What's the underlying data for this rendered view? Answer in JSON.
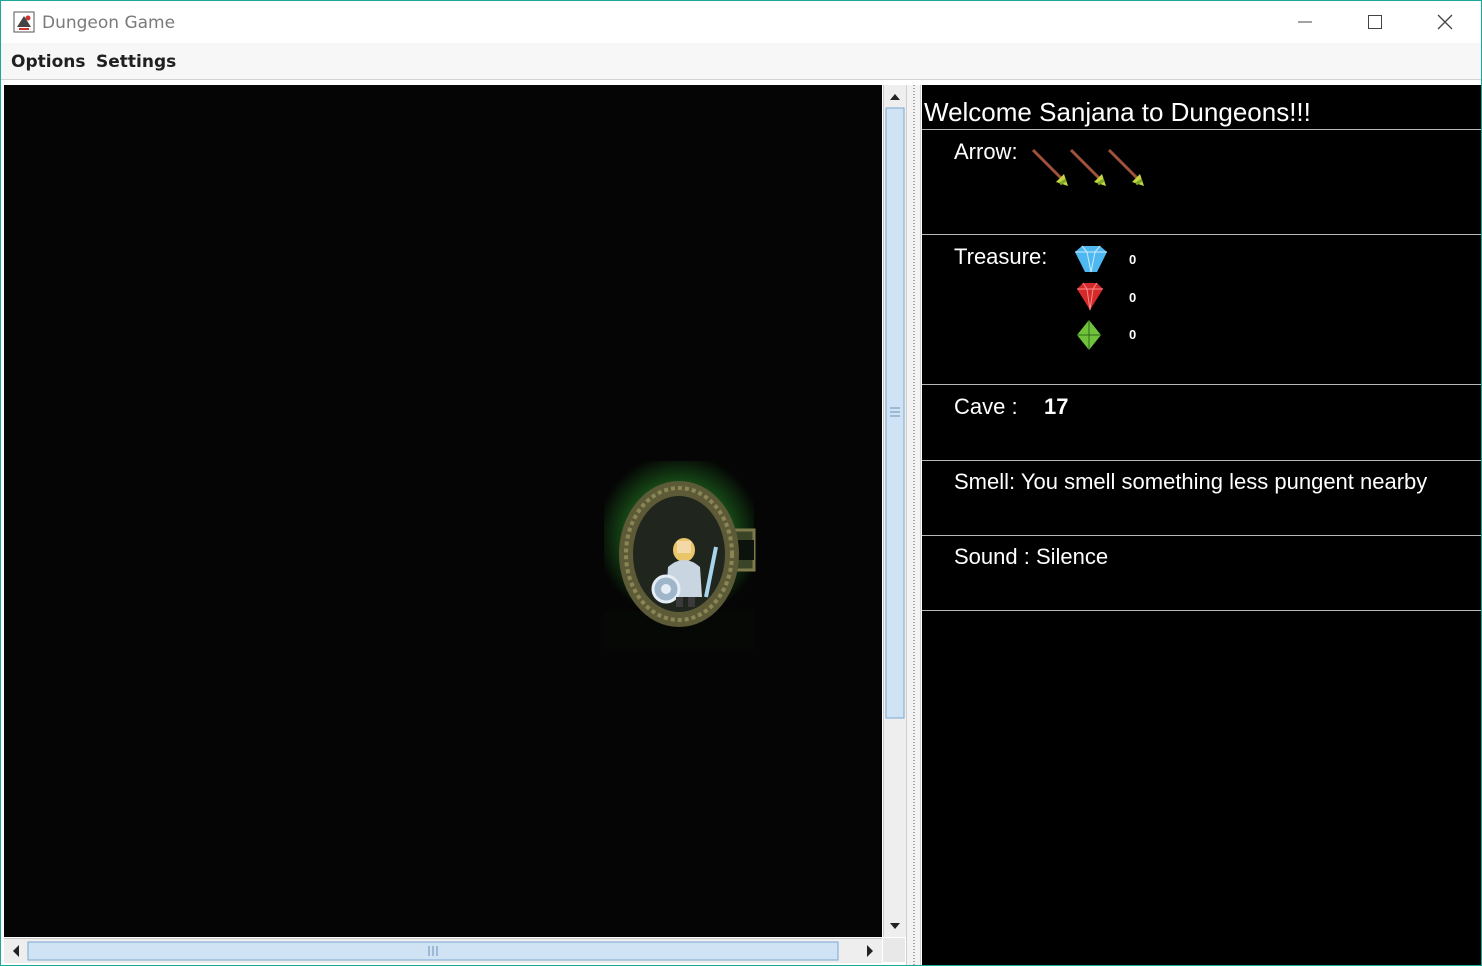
{
  "window": {
    "title": "Dungeon Game"
  },
  "menu": {
    "items": [
      "Options",
      "Settings"
    ]
  },
  "panel": {
    "welcome": "Welcome Sanjana to Dungeons!!!",
    "arrow": {
      "label": "Arrow:",
      "count": 3
    },
    "treasure": {
      "label": "Treasure:",
      "items": [
        {
          "icon": "diamond-icon",
          "count": "0",
          "color": "#4fb8f0"
        },
        {
          "icon": "ruby-icon",
          "count": "0",
          "color": "#d42a2a"
        },
        {
          "icon": "emerald-icon",
          "count": "0",
          "color": "#6fc23a"
        }
      ]
    },
    "cave": {
      "label": "Cave :",
      "value": "17"
    },
    "smell": {
      "text": "Smell: You smell something less pungent nearby"
    },
    "sound": {
      "text": "Sound : Silence"
    }
  },
  "colors": {
    "background": "#000000",
    "text": "#ffffff",
    "cave_glow": "#1f6b1f"
  }
}
